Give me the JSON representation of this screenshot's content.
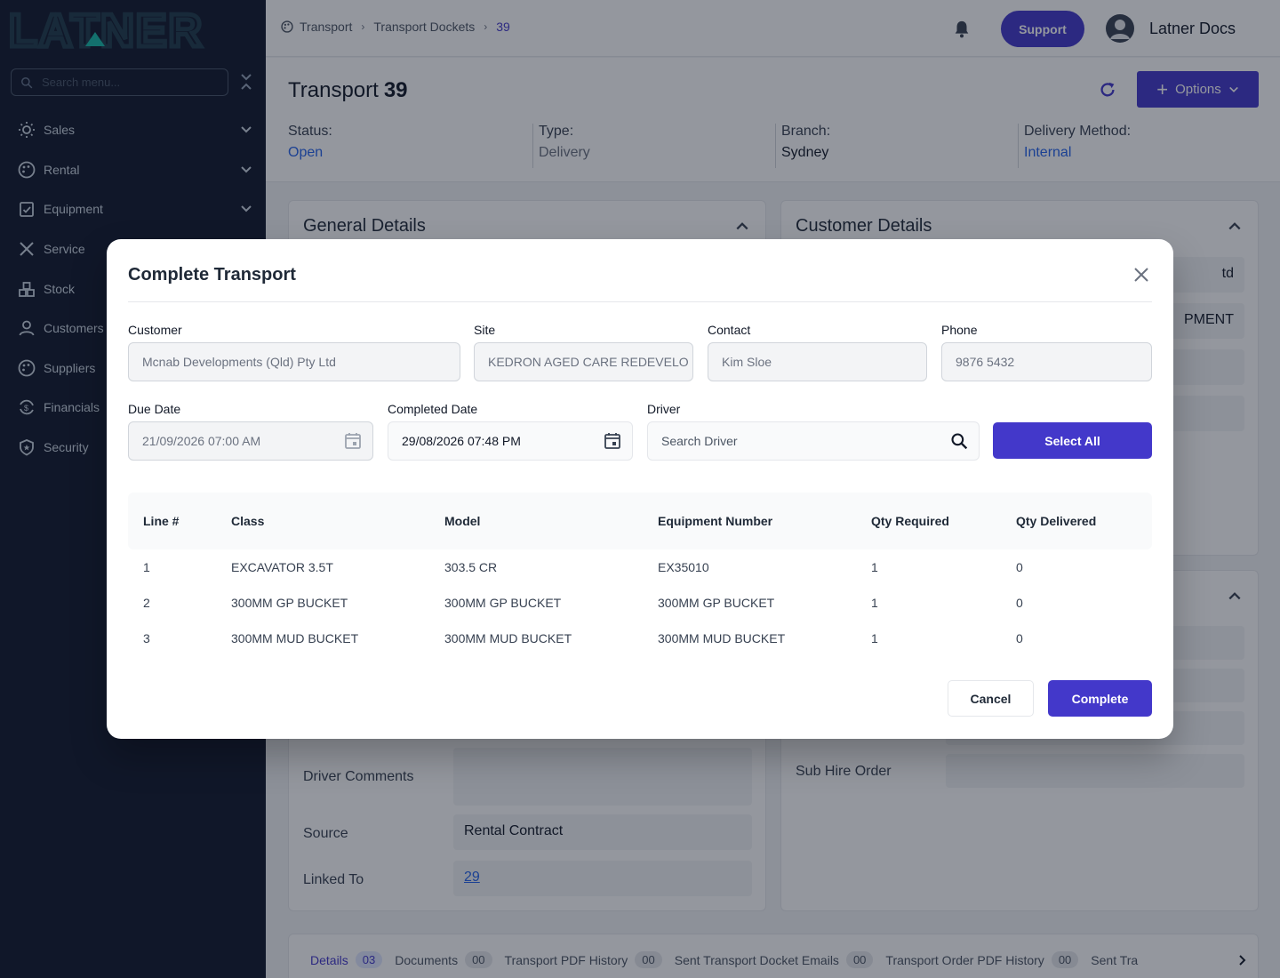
{
  "brand": {
    "logo_text": "LATNER"
  },
  "sidebar": {
    "search_placeholder": "Search menu...",
    "items": [
      {
        "label": "Sales",
        "icon": "sun-icon",
        "has_children": true
      },
      {
        "label": "Rental",
        "icon": "palette-icon",
        "has_children": true
      },
      {
        "label": "Equipment",
        "icon": "clipboard-check-icon",
        "has_children": true
      },
      {
        "label": "Service",
        "icon": "tools-icon",
        "has_children": false
      },
      {
        "label": "Stock",
        "icon": "boxes-icon",
        "has_children": false
      },
      {
        "label": "Customers",
        "icon": "person-icon",
        "has_children": false
      },
      {
        "label": "Suppliers",
        "icon": "palette-icon",
        "has_children": false
      },
      {
        "label": "Financials",
        "icon": "dollar-cycle-icon",
        "has_children": false
      },
      {
        "label": "Security",
        "icon": "shield-icon",
        "has_children": false
      }
    ]
  },
  "topbar": {
    "breadcrumbs": [
      "Transport",
      "Transport Dockets",
      "39"
    ],
    "support_label": "Support",
    "user_name": "Latner Docs"
  },
  "page": {
    "title": "Transport",
    "number": "39",
    "options_label": "Options",
    "meta": [
      {
        "label": "Status:",
        "value": "Open",
        "color": "#2563eb"
      },
      {
        "label": "Type:",
        "value": "Delivery",
        "color": "#6b7280"
      },
      {
        "label": "Branch:",
        "value": "Sydney",
        "color": "#111827"
      },
      {
        "label": "Delivery Method:",
        "value": "Internal",
        "color": "#2563eb"
      }
    ]
  },
  "general_card": {
    "title": "General Details",
    "fields": [
      {
        "label": "Driver Comments",
        "value": ""
      },
      {
        "label": "Source",
        "value": "Rental Contract"
      },
      {
        "label": "Linked To",
        "value": "29"
      }
    ]
  },
  "customer_card": {
    "title": "Customer Details",
    "peek_1": "td",
    "peek_2": "PMENT",
    "sub_hire_label": "Sub Hire Order"
  },
  "tabs": [
    {
      "label": "Details",
      "count": "03"
    },
    {
      "label": "Documents",
      "count": "00"
    },
    {
      "label": "Transport PDF History",
      "count": "00"
    },
    {
      "label": "Sent Transport Docket Emails",
      "count": "00"
    },
    {
      "label": "Transport Order PDF History",
      "count": "00"
    },
    {
      "label": "Sent Tra",
      "count": ""
    }
  ],
  "modal": {
    "title": "Complete Transport",
    "customer": {
      "label": "Customer",
      "value": "Mcnab Developments (Qld) Pty Ltd"
    },
    "site": {
      "label": "Site",
      "value": "KEDRON AGED CARE REDEVELO"
    },
    "contact": {
      "label": "Contact",
      "value": "Kim Sloe"
    },
    "phone": {
      "label": "Phone",
      "value": "9876 5432"
    },
    "due_date": {
      "label": "Due Date",
      "value": "21/09/2026 07:00 AM"
    },
    "completed_date": {
      "label": "Completed Date",
      "value": "29/08/2026 07:48 PM"
    },
    "driver": {
      "label": "Driver",
      "placeholder": "Search Driver"
    },
    "select_all_label": "Select All",
    "table": {
      "headers": [
        "Line #",
        "Class",
        "Model",
        "Equipment Number",
        "Qty Required",
        "Qty Delivered"
      ],
      "rows": [
        [
          "1",
          "EXCAVATOR 3.5T",
          "303.5 CR",
          "EX35010",
          "1",
          "0"
        ],
        [
          "2",
          "300MM GP BUCKET",
          "300MM GP BUCKET",
          "300MM GP BUCKET",
          "1",
          "0"
        ],
        [
          "3",
          "300MM MUD BUCKET",
          "300MM MUD BUCKET",
          "300MM MUD BUCKET",
          "1",
          "0"
        ]
      ]
    },
    "cancel_label": "Cancel",
    "complete_label": "Complete"
  }
}
